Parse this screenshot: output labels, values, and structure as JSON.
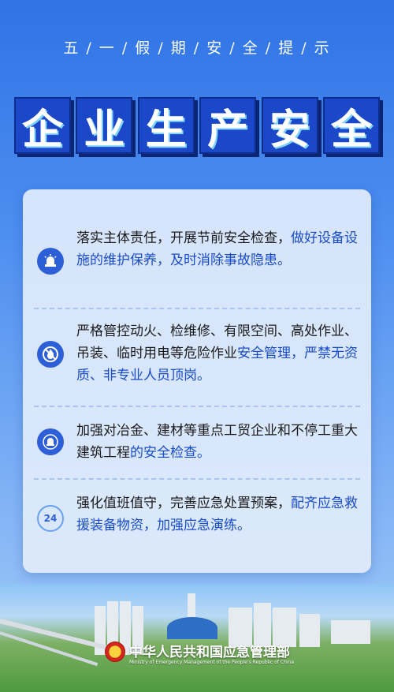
{
  "header": {
    "subtitle": "五 / 一 / 假 / 期 / 安 / 全 / 提 / 示",
    "title_chars": [
      "企",
      "业",
      "生",
      "产",
      "安",
      "全"
    ]
  },
  "items": [
    {
      "icon": "alarm-siren-icon",
      "text_normal": "落实主体责任，开展节前安全检查，",
      "text_highlight": "做好设备设施的维护保养，及时消除事故隐患。"
    },
    {
      "icon": "no-fire-icon",
      "text_normal": "严格管控动火、检维修、有限空间、高处作业、吊装、临时用电等危险作业",
      "text_highlight": "安全管理，严禁无资质、非专业人员顶岗。"
    },
    {
      "icon": "bell-alert-icon",
      "text_normal": "加强对冶金、建材等重点工贸企业和不停工重大建筑工程",
      "text_highlight": "的安全检查。"
    },
    {
      "icon": "24h-clock-icon",
      "text_normal": "强化值班值守，完善应急处置预案，",
      "text_highlight": "配齐应急救援装备物资，加强应急演练。"
    }
  ],
  "item4_icon_label": "24",
  "footer": {
    "org_cn": "中华人民共和国应急管理部",
    "org_en": "Ministry of Emergency Management of the People's Republic of China"
  },
  "colors": {
    "background_top": "#2f73e6",
    "title_block": "#1b47c9",
    "highlight_text": "#1a4cc9",
    "card": "#e1ecfc"
  }
}
